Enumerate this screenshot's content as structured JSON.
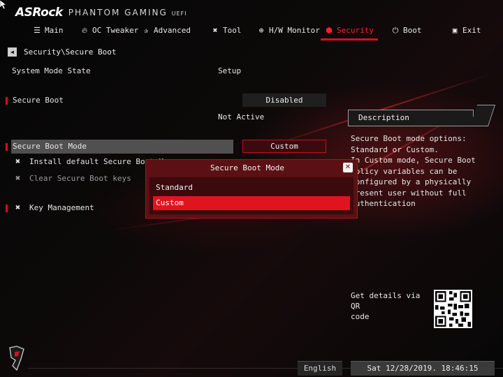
{
  "header": {
    "brand": "ASRock",
    "product": "PHANTOM GAMING",
    "product_suffix": "UEFI"
  },
  "nav": {
    "items": [
      {
        "label": "Main",
        "icon": "list-icon"
      },
      {
        "label": "OC Tweaker",
        "icon": "flame-icon"
      },
      {
        "label": "Advanced",
        "icon": "star-icon"
      },
      {
        "label": "Tool",
        "icon": "tools-icon"
      },
      {
        "label": "H/W Monitor",
        "icon": "globe-icon"
      },
      {
        "label": "Security",
        "icon": "shield-icon"
      },
      {
        "label": "Boot",
        "icon": "power-icon"
      },
      {
        "label": "Exit",
        "icon": "door-icon"
      }
    ],
    "active": "Security"
  },
  "breadcrumb": {
    "text": "Security\\Secure Boot"
  },
  "settings": {
    "system_mode_label": "System Mode State",
    "system_mode_value": "Setup",
    "secure_boot_label": "Secure Boot",
    "secure_boot_value": "Disabled",
    "secure_boot_status": "Not Active",
    "secure_boot_mode_label": "Secure Boot Mode",
    "secure_boot_mode_value": "Custom",
    "install_keys_label": "Install default Secure Boot Keys",
    "clear_keys_label": "Clear Secure Boot keys",
    "key_management_label": "Key Management"
  },
  "description": {
    "title": "Description",
    "text": "Secure Boot mode options:\nStandard or Custom.\nIn Custom mode, Secure Boot\nPolicy variables can be\nconfigured by a physically\npresent user without full\nauthentication"
  },
  "qr": {
    "label": "Get details via QR\ncode"
  },
  "popup": {
    "title": "Secure Boot Mode",
    "options": [
      "Standard",
      "Custom"
    ],
    "selected": "Custom"
  },
  "footer": {
    "language": "English",
    "datetime": "Sat 12/28/2019. 18:46:15"
  },
  "colors": {
    "accent": "#d3121d",
    "popup_bg": "#5b1014",
    "popup_selected": "#e0141f",
    "text": "#e6e6e6"
  }
}
